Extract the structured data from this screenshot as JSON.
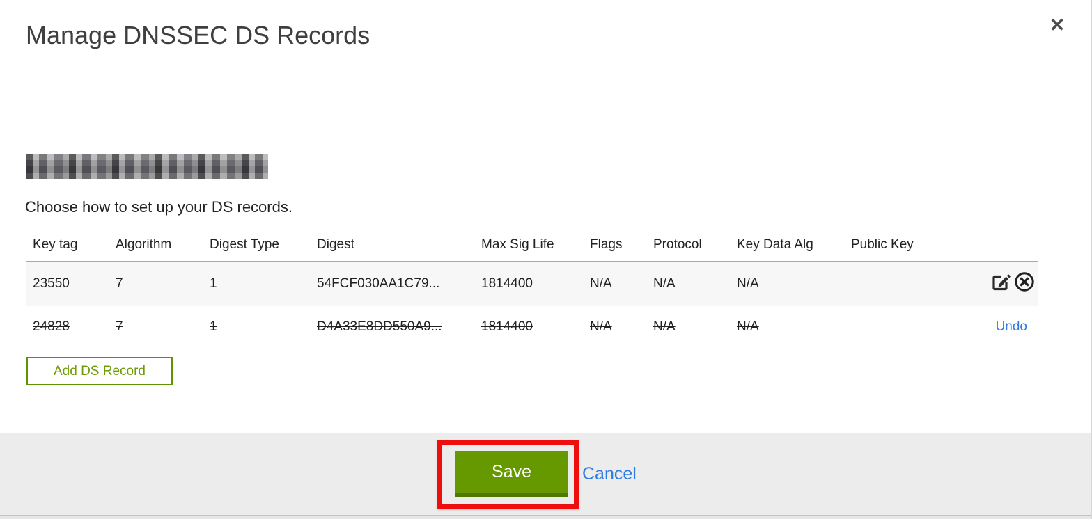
{
  "modal": {
    "title": "Manage DNSSEC DS Records",
    "close_icon": "✕",
    "domain": {
      "redacted": true
    },
    "instruction": "Choose how to set up your DS records."
  },
  "table": {
    "columns": [
      "Key tag",
      "Algorithm",
      "Digest Type",
      "Digest",
      "Max Sig Life",
      "Flags",
      "Protocol",
      "Key Data Alg",
      "Public Key"
    ],
    "rows": [
      {
        "key_tag": "23550",
        "algorithm": "7",
        "digest_type": "1",
        "digest": "54FCF030AA1C79...",
        "max_sig_life": "1814400",
        "flags": "N/A",
        "protocol": "N/A",
        "key_data_alg": "N/A",
        "public_key": "",
        "state": "normal",
        "actions": [
          "edit",
          "delete"
        ]
      },
      {
        "key_tag": "24828",
        "algorithm": "7",
        "digest_type": "1",
        "digest": "D4A33E8DD550A9...",
        "max_sig_life": "1814400",
        "flags": "N/A",
        "protocol": "N/A",
        "key_data_alg": "N/A",
        "public_key": "",
        "state": "deleted",
        "undo_label": "Undo"
      }
    ]
  },
  "buttons": {
    "add_ds_record": "Add DS Record",
    "save": "Save",
    "cancel": "Cancel"
  },
  "colors": {
    "green_button": "#669900",
    "green_button_border": "#507800",
    "green_outline_button": "#5d9400",
    "link_blue": "#2d7ce4",
    "annotation_red": "#ee0e0e",
    "row_alt_background": "#f7f7f7",
    "footer_background": "#ececec"
  },
  "annotation": {
    "type": "red-highlight-box",
    "target": "save-button"
  }
}
